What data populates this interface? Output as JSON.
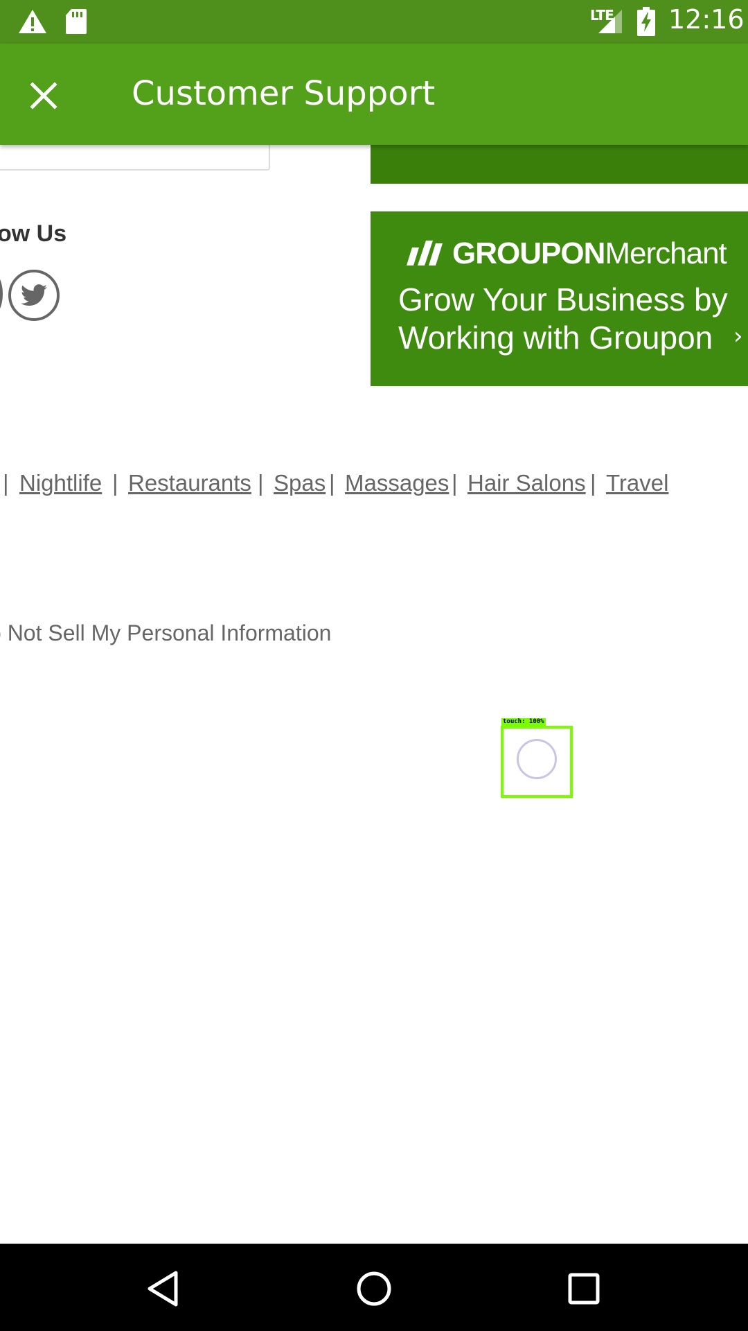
{
  "status_bar": {
    "network_label": "LTE",
    "time": "12:16",
    "icons": [
      "warning-icon",
      "sd-card-icon",
      "signal-icon",
      "battery-charging-icon"
    ]
  },
  "app_bar": {
    "title": "Customer Support",
    "close_icon": "close-icon"
  },
  "footer": {
    "follow_heading": "ow Us",
    "social_icons": [
      "social-icon-partial",
      "twitter-icon"
    ],
    "merchant_banner": {
      "brand_bold": "GROUPON",
      "brand_light": "Merchant",
      "line1": "Grow Your Business by",
      "line2": "Working with Groupon",
      "chevron": "›"
    },
    "categories": [
      {
        "label": "Nightlife"
      },
      {
        "label": "Restaurants"
      },
      {
        "label": "Spas"
      },
      {
        "label": "Massages"
      },
      {
        "label": "Hair Salons"
      },
      {
        "label": "Travel"
      }
    ],
    "separator": "|",
    "privacy_link": "o Not Sell My Personal Information"
  },
  "touch_indicator": {
    "label": "touch: 100%"
  },
  "nav_bar": {
    "icons": [
      "back-icon",
      "home-icon",
      "recents-icon"
    ]
  },
  "colors": {
    "status_bar": "#4f8f1c",
    "app_bar": "#53a01b",
    "banner": "#3f8b0f",
    "touch_box": "#7cfc00"
  }
}
